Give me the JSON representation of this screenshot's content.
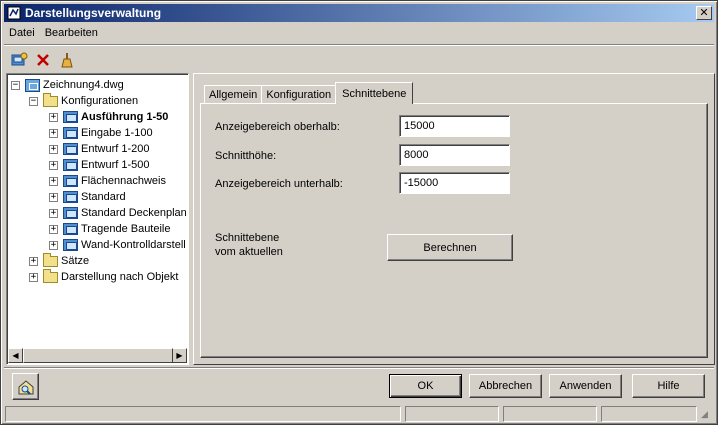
{
  "window": {
    "title": "Darstellungsverwaltung",
    "close_glyph": "✕"
  },
  "menu": [
    "Datei",
    "Bearbeiten"
  ],
  "toolbar": {
    "icons": [
      "new-config-icon",
      "delete-icon",
      "purge-icon"
    ]
  },
  "tree": {
    "root": "Zeichnung4.dwg",
    "group_configs": "Konfigurationen",
    "configs": [
      "Ausführung 1-50",
      "Eingabe 1-100",
      "Entwurf 1-200",
      "Entwurf 1-500",
      "Flächennachweis",
      "Standard",
      "Standard Deckenplan",
      "Tragende Bauteile",
      "Wand-Kontrolldarstell"
    ],
    "group_sets": "Sätze",
    "group_objects": "Darstellung nach Objekt",
    "expand_glyph": "+",
    "collapse_glyph": "−"
  },
  "tabs": [
    "Allgemein",
    "Konfiguration",
    "Schnittebene"
  ],
  "active_tab": "Schnittebene",
  "form": {
    "above_label": "Anzeigebereich oberhalb:",
    "above_value": "15000",
    "cut_label": "Schnitthöhe:",
    "cut_value": "8000",
    "below_label": "Anzeigebereich unterhalb:",
    "below_value": "-15000",
    "from_current_line1": "Schnittebene",
    "from_current_line2": "vom aktuellen",
    "calc_label": "Berechnen"
  },
  "buttons": {
    "ok": "OK",
    "cancel": "Abbrechen",
    "apply": "Anwenden",
    "help": "Hilfe"
  }
}
